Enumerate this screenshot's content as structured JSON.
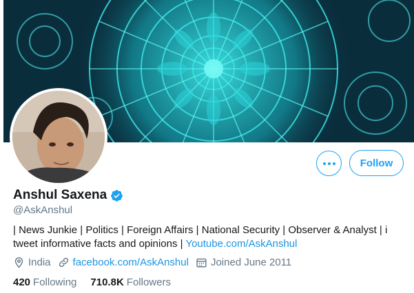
{
  "profile": {
    "display_name": "Anshul Saxena",
    "handle": "@AskAnshul",
    "verified": true,
    "bio_text": "| News Junkie | Politics | Foreign Affairs | National Security | Observer & Analyst | i tweet informative facts and opinions |",
    "bio_link": "Youtube.com/AskAnshul"
  },
  "actions": {
    "more_icon": "more-dots-icon",
    "follow_label": "Follow"
  },
  "meta": {
    "location": "India",
    "location_icon": "location-pin-icon",
    "website": "facebook.com/AskAnshul",
    "website_icon": "link-icon",
    "joined": "Joined June 2011",
    "joined_icon": "calendar-icon"
  },
  "stats": {
    "following_count": "420",
    "following_label": "Following",
    "followers_count": "710.8K",
    "followers_label": "Followers"
  },
  "colors": {
    "accent": "#1da1f2",
    "link": "#1b95e0",
    "text": "#14171a",
    "muted": "#657786",
    "banner_cyan": "#2fd6e0"
  }
}
